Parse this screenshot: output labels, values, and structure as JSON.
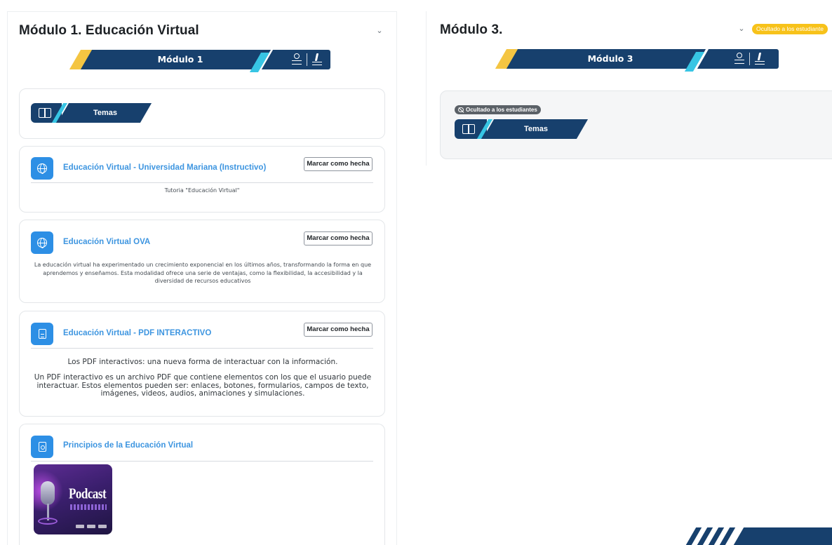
{
  "left": {
    "module_title": "Módulo 1. Educación Virtual",
    "banner_label": "Módulo 1",
    "topic_label": "Temas",
    "activities": [
      {
        "title": "Educación Virtual - Universidad Mariana (Instructivo)",
        "icon": "globe-icon",
        "button": "Marcar como hecha",
        "description": "Tutoria \"Educación Virtual\""
      },
      {
        "title": "Educación Virtual OVA",
        "icon": "globe-icon",
        "button": "Marcar como hecha",
        "description_lines": [
          "La educación virtual ha experimentado un crecimiento exponencial en los últimos años, transformando la forma en que",
          "aprendemos y enseñamos. Esta modalidad ofrece una serie de ventajas, como la flexibilidad, la accesibilidad y la",
          "diversidad de recursos educativos"
        ]
      },
      {
        "title": "Educación Virtual - PDF INTERACTIVO",
        "icon": "pdf-file-icon",
        "button": "Marcar como hecha",
        "lead": "Los PDF interactivos: una nueva forma de interactuar con la información.",
        "body_lines": [
          "Un PDF interactivo es un archivo PDF que contiene elementos con los que el usuario puede",
          "interactuar. Estos elementos pueden ser: enlaces, botones, formularios, campos de texto,",
          "imágenes, videos, audios, animaciones y simulaciones."
        ]
      },
      {
        "title": "Principios de la Educación Virtual",
        "icon": "document-icon",
        "thumbnail_title": "Podcast"
      }
    ]
  },
  "right": {
    "module_title": "Módulo 3.",
    "hidden_badge": "Ocultado a los estudiante",
    "banner_label": "Módulo 3",
    "hidden_pill": "Ocultado a los estudiantes",
    "topic_label": "Temas"
  },
  "colors": {
    "brand_navy": "#17406d",
    "accent_cyan": "#37c5e4",
    "accent_yellow": "#f4c542",
    "link_blue": "#3d95e0",
    "icon_blue": "#2d8fe5"
  }
}
